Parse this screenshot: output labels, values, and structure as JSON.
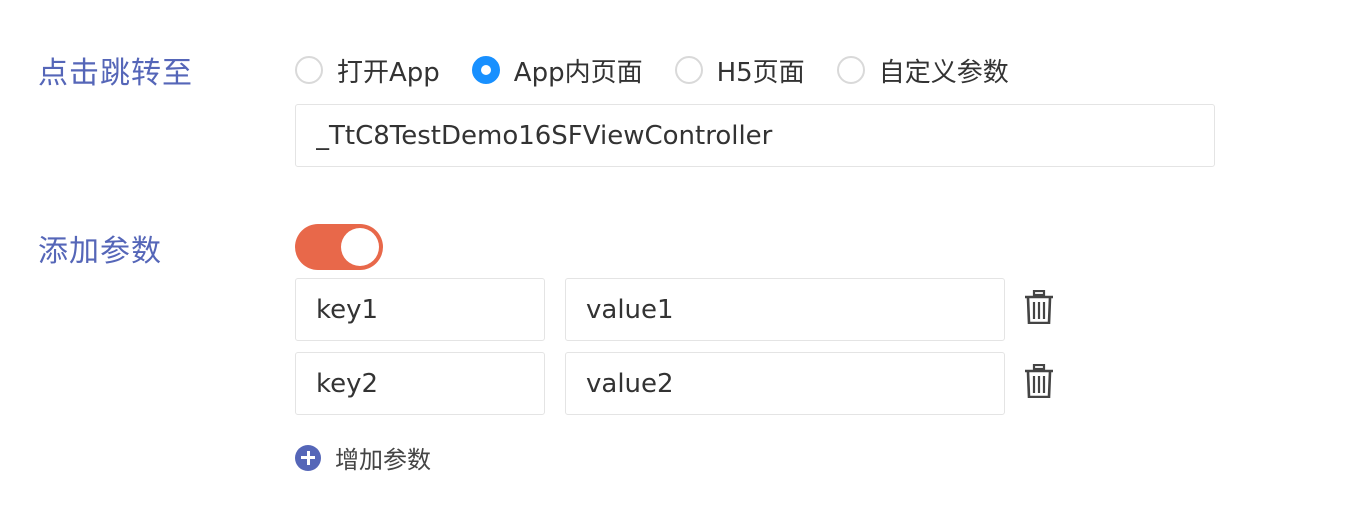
{
  "jump": {
    "label": "点击跳转至",
    "options": [
      {
        "label": "打开App",
        "checked": false
      },
      {
        "label": "App内页面",
        "checked": true
      },
      {
        "label": "H5页面",
        "checked": false
      },
      {
        "label": "自定义参数",
        "checked": false
      }
    ],
    "target_value": "_TtC8TestDemo16SFViewController"
  },
  "params": {
    "label": "添加参数",
    "toggle_on": true,
    "rows": [
      {
        "key": "key1",
        "value": "value1"
      },
      {
        "key": "key2",
        "value": "value2"
      }
    ],
    "add_label": "增加参数"
  },
  "colors": {
    "label": "#5566b8",
    "radio_checked": "#1890ff",
    "toggle_on": "#e8684a"
  }
}
